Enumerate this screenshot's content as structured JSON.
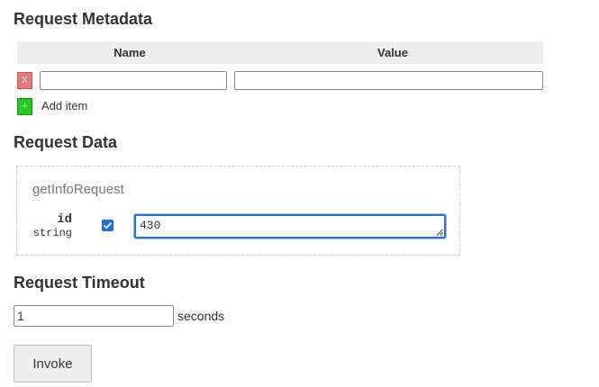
{
  "metadata": {
    "heading": "Request Metadata",
    "columns": {
      "name": "Name",
      "value": "Value"
    },
    "rows": [
      {
        "remove_label": "X",
        "name": "",
        "value": ""
      }
    ],
    "add_button_label": "+",
    "add_item_label": "Add item"
  },
  "request_data": {
    "heading": "Request Data",
    "message_type": "getInfoRequest",
    "fields": [
      {
        "name": "id",
        "type": "string",
        "included": true,
        "value": "430"
      }
    ]
  },
  "timeout": {
    "heading": "Request Timeout",
    "value": "1",
    "unit": "seconds"
  },
  "invoke": {
    "label": "Invoke"
  },
  "colors": {
    "remove_button": "#e8787a",
    "add_button": "#22cc22",
    "focus_border": "#2e6fc8",
    "checkbox": "#1e6fd9"
  }
}
